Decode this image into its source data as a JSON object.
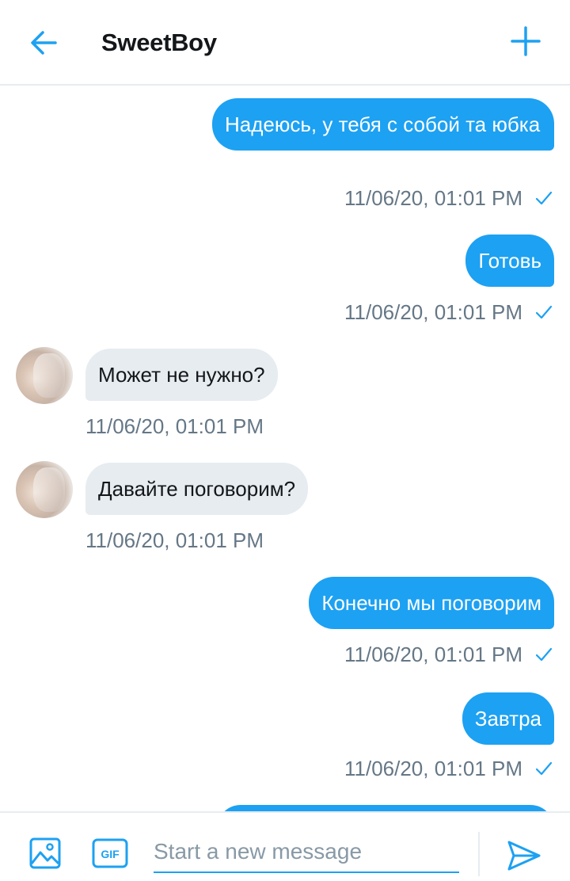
{
  "header": {
    "title": "SweetBoy",
    "back_icon": "arrow-left-icon",
    "action_icon": "plus-icon"
  },
  "messages": [
    {
      "direction": "out",
      "text": "Надеюсь, у тебя с собой та юбка",
      "timestamp": "11/06/20, 01:01 PM",
      "read": true
    },
    {
      "direction": "out",
      "text": "Готовь",
      "timestamp": "11/06/20, 01:01 PM",
      "read": true
    },
    {
      "direction": "in",
      "text": "Может не нужно?",
      "timestamp": "11/06/20, 01:01 PM"
    },
    {
      "direction": "in",
      "text": "Давайте поговорим?",
      "timestamp": "11/06/20, 01:01 PM"
    },
    {
      "direction": "out",
      "text": "Конечно мы поговорим",
      "timestamp": "11/06/20, 01:01 PM",
      "read": true
    },
    {
      "direction": "out",
      "text": "Завтра",
      "timestamp": "11/06/20, 01:01 PM",
      "read": true
    }
  ],
  "composer": {
    "placeholder": "Start a new message",
    "value": "",
    "media_icon": "image-icon",
    "gif_label": "GIF",
    "send_icon": "send-icon"
  },
  "colors": {
    "accent": "#1da1f2",
    "incoming_bubble": "#e6ecf0",
    "meta_text": "#657786"
  }
}
